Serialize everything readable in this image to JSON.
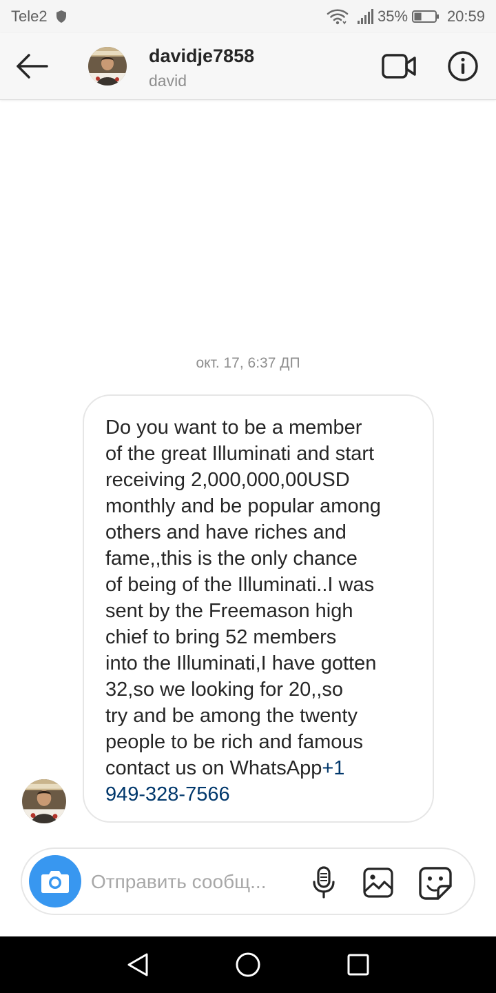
{
  "status_bar": {
    "carrier": "Tele2",
    "battery_percent": "35%",
    "battery_level": 0.35,
    "time": "20:59",
    "icons": [
      "shield-icon",
      "wifi-icon",
      "signal-icon",
      "battery-icon"
    ]
  },
  "header": {
    "username": "davidje7858",
    "full_name": "david",
    "icons": [
      "back-arrow-icon",
      "video-camera-icon",
      "info-icon"
    ]
  },
  "thread": {
    "timestamp": "окт. 17, 6:37 ДП",
    "message": {
      "text": "Do you want to be a member\nof the great Illuminati and start\nreceiving 2,000,000,00USD\nmonthly and be popular among\nothers and have riches and\nfame,,this is the only chance\nof being of the Illuminati..I was\nsent by the Freemason high\nchief to bring 52 members\ninto the Illuminati,I have gotten\n32,so we looking for 20,,so\ntry and be among the twenty\npeople to be rich and famous\ncontact us on WhatsApp",
      "phone_link": "+1\n949-328-7566"
    }
  },
  "composer": {
    "placeholder": "Отправить сообщ...",
    "icons": [
      "camera-icon",
      "microphone-icon",
      "gallery-icon",
      "sticker-icon"
    ]
  },
  "nav_bar": {
    "icons": [
      "nav-back-icon",
      "nav-home-icon",
      "nav-recents-icon"
    ]
  },
  "colors": {
    "accent": "#3897f0",
    "link": "#00376b",
    "text_primary": "#262626",
    "text_secondary": "#8e8e8e"
  }
}
